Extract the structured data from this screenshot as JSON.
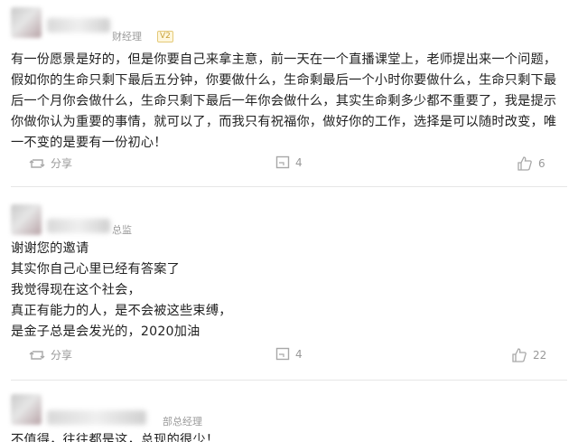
{
  "posts": [
    {
      "title": "财经理",
      "badge": "V2",
      "text": "有一份愿景是好的，但是你要自己来拿主意，前一天在一个直播课堂上，老师提出来一个问题，假如你的生命只剩下最后五分钟，你要做什么，生命剩最后一个小时你要做什么，生命只剩下最后一个月你会做什么，生命只剩下最后一年你会做什么，其实生命剩多少都不重要了，我是提示你做你认为重要的事情，就可以了，而我只有祝福你，做好你的工作，选择是可以随时改变，唯一不变的是要有一份初心！",
      "share_label": "分享",
      "comment_count": "4",
      "like_count": "6"
    },
    {
      "title": "总监",
      "text": "谢谢您的邀请\n其实你自己心里已经有答案了\n我觉得现在这个社会，\n真正有能力的人，是不会被这些束缚，\n是金子总是会发光的，2020加油",
      "share_label": "分享",
      "comment_count": "4",
      "like_count": "22"
    },
    {
      "title": "部总经理",
      "text": "不值得，往往都是这，总现的很少！"
    }
  ],
  "colors": {
    "text": "#222222",
    "meta": "#999999",
    "divider": "#e7e7e7"
  },
  "icons": {
    "share": "share-icon",
    "comment": "comment-icon",
    "like": "thumbs-up-icon"
  }
}
